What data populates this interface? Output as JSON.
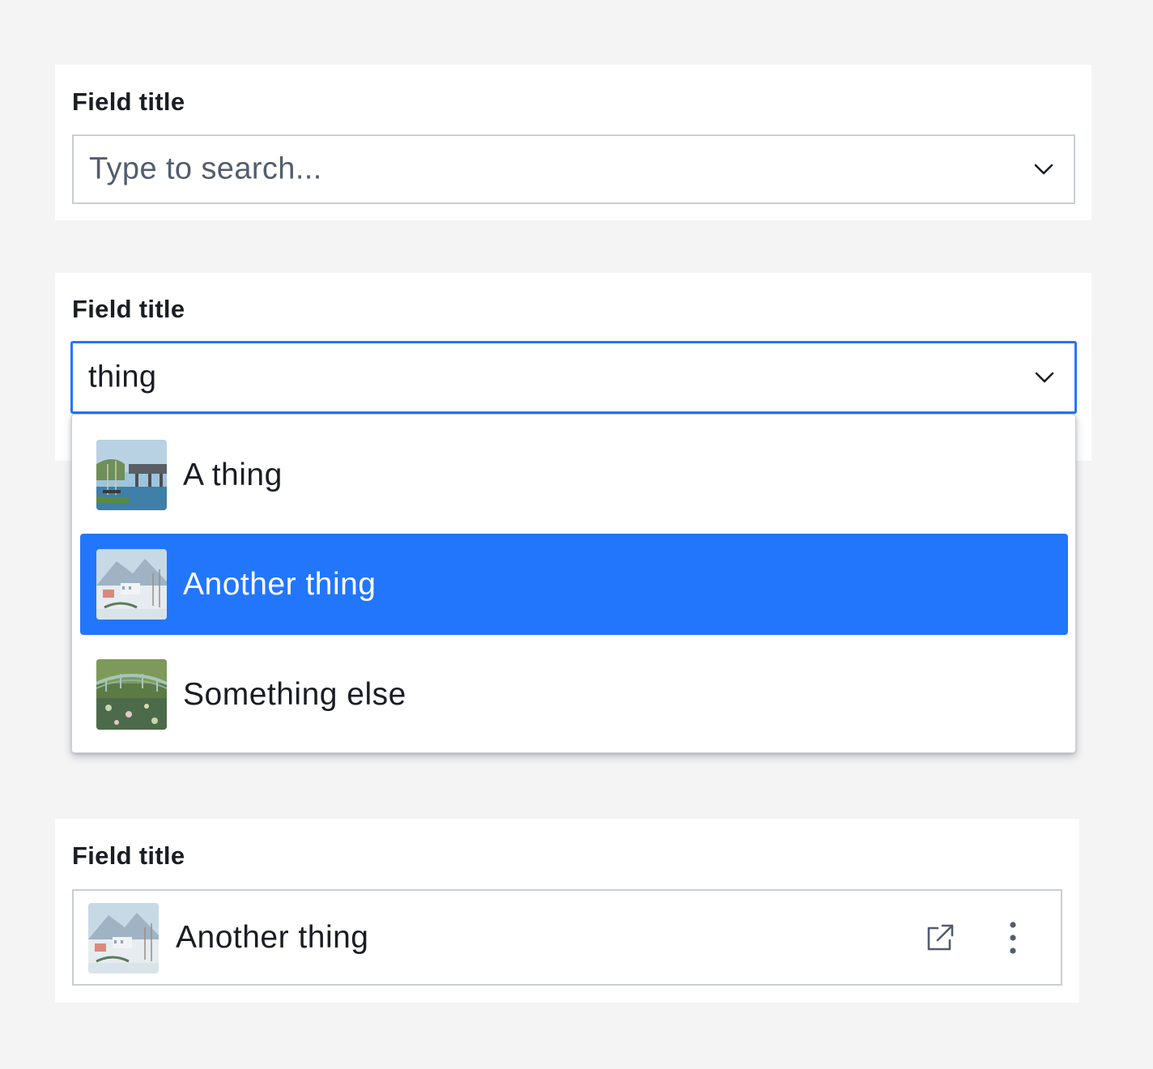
{
  "fields": [
    {
      "title": "Field title",
      "state": "empty",
      "input": {
        "placeholder": "Type to search...",
        "value": ""
      },
      "toggle_icon": "chevron-down-icon"
    },
    {
      "title": "Field title",
      "state": "searching",
      "input": {
        "placeholder": "",
        "value": "thing"
      },
      "toggle_icon": "chevron-down-icon",
      "options": [
        {
          "label": "A thing",
          "thumbnail": "bridge-painting-thumbnail",
          "highlighted": false
        },
        {
          "label": "Another thing",
          "thumbnail": "snowy-village-painting-thumbnail",
          "highlighted": true
        },
        {
          "label": "Something else",
          "thumbnail": "water-lily-bridge-painting-thumbnail",
          "highlighted": false
        }
      ]
    },
    {
      "title": "Field title",
      "state": "selected",
      "selected": {
        "label": "Another thing",
        "thumbnail": "snowy-village-painting-thumbnail"
      },
      "actions": [
        "external-link-icon",
        "more-vertical-icon"
      ]
    }
  ],
  "colors": {
    "accent": "#2276fc",
    "border": "#c9ced6",
    "text": "#1a1d24",
    "placeholder": "#525d6e",
    "background": "#f4f4f4",
    "card": "#ffffff"
  }
}
